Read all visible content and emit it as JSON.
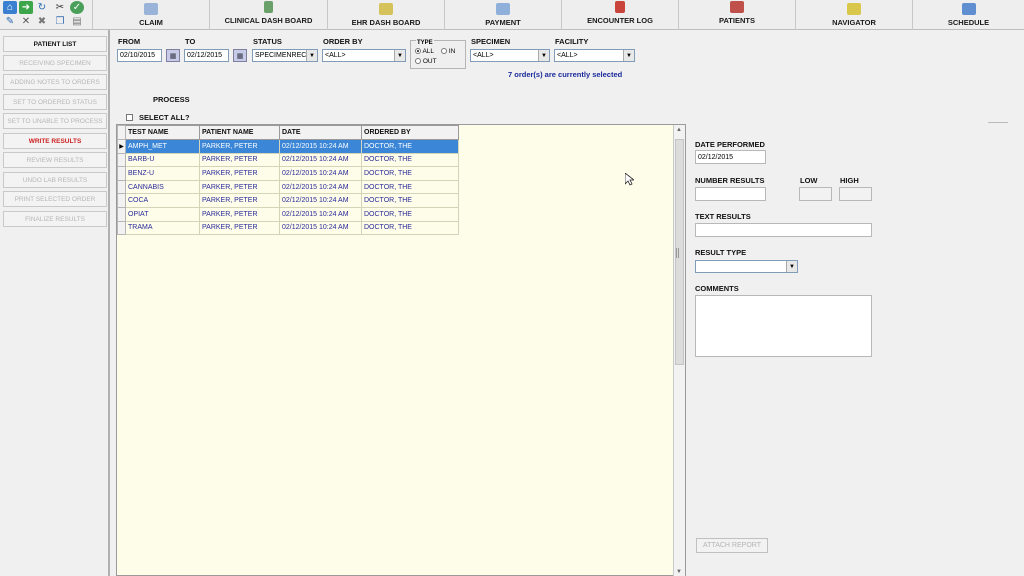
{
  "toolbar": {
    "buttons": [
      {
        "label": "CLAIM",
        "icon": "claim-icon"
      },
      {
        "label": "CLINICAL DASH BOARD",
        "icon": "clinical-dashboard-icon"
      },
      {
        "label": "EHR DASH BOARD",
        "icon": "ehr-dashboard-icon"
      },
      {
        "label": "PAYMENT",
        "icon": "payment-icon"
      },
      {
        "label": "ENCOUNTER LOG",
        "icon": "encounter-log-icon"
      },
      {
        "label": "PATIENTS",
        "icon": "patients-icon"
      },
      {
        "label": "NAVIGATOR",
        "icon": "navigator-icon"
      },
      {
        "label": "SCHEDULE",
        "icon": "schedule-icon"
      }
    ]
  },
  "sidebar": {
    "items": [
      {
        "label": "PATIENT LIST"
      },
      {
        "label": "RECEIVING SPECIMEN"
      },
      {
        "label": "ADDING NOTES TO ORDERS"
      },
      {
        "label": "SET TO ORDERED STATUS"
      },
      {
        "label": "SET TO UNABLE TO PROCESS"
      },
      {
        "label": "WRITE RESULTS"
      },
      {
        "label": "REVIEW RESULTS"
      },
      {
        "label": "UNDO LAB RESULTS"
      },
      {
        "label": "PRINT SELECTED ORDER"
      },
      {
        "label": "FINALIZE RESULTS"
      }
    ]
  },
  "filters": {
    "from_label": "FROM",
    "from_value": "02/10/2015",
    "to_label": "TO",
    "to_value": "02/12/2015",
    "status_label": "STATUS",
    "status_value": "SPECIMENRECI",
    "order_by_label": "ORDER BY",
    "order_by_value": "<ALL>",
    "type_label": "TYPE",
    "type_all": "ALL",
    "type_in": "IN",
    "type_out": "OUT",
    "specimen_label": "SPECIMEN",
    "specimen_value": "<ALL>",
    "facility_label": "FACILITY",
    "facility_value": "<ALL>",
    "selected_note": "7 order(s) are currently selected"
  },
  "process": {
    "label": "PROCESS",
    "select_all": "SELECT ALL?"
  },
  "grid": {
    "headers": [
      "TEST NAME",
      "PATIENT NAME",
      "DATE",
      "ORDERED BY"
    ],
    "rows": [
      [
        "AMPH_MET",
        "PARKER, PETER",
        "02/12/2015 10:24 AM",
        "DOCTOR, THE"
      ],
      [
        "BARB-U",
        "PARKER, PETER",
        "02/12/2015 10:24 AM",
        "DOCTOR, THE"
      ],
      [
        "BENZ-U",
        "PARKER, PETER",
        "02/12/2015 10:24 AM",
        "DOCTOR, THE"
      ],
      [
        "CANNABIS",
        "PARKER, PETER",
        "02/12/2015 10:24 AM",
        "DOCTOR, THE"
      ],
      [
        "COCA",
        "PARKER, PETER",
        "02/12/2015 10:24 AM",
        "DOCTOR, THE"
      ],
      [
        "OPIAT",
        "PARKER, PETER",
        "02/12/2015 10:24 AM",
        "DOCTOR, THE"
      ],
      [
        "TRAMA",
        "PARKER, PETER",
        "02/12/2015 10:24 AM",
        "DOCTOR, THE"
      ]
    ]
  },
  "results_panel": {
    "date_performed_label": "DATE PERFORMED",
    "date_performed_value": "02/12/2015",
    "number_results_label": "NUMBER RESULTS",
    "low_label": "LOW",
    "high_label": "HIGH",
    "text_results_label": "TEXT RESULTS",
    "result_type_label": "RESULT TYPE",
    "comments_label": "COMMENTS",
    "attach_report": "ATTACH REPORT"
  },
  "colors": {
    "grid_bg": "#fefde9",
    "selected_row": "#3b86d6",
    "active_item": "#cc2020",
    "note_text": "#1a2a9a"
  }
}
